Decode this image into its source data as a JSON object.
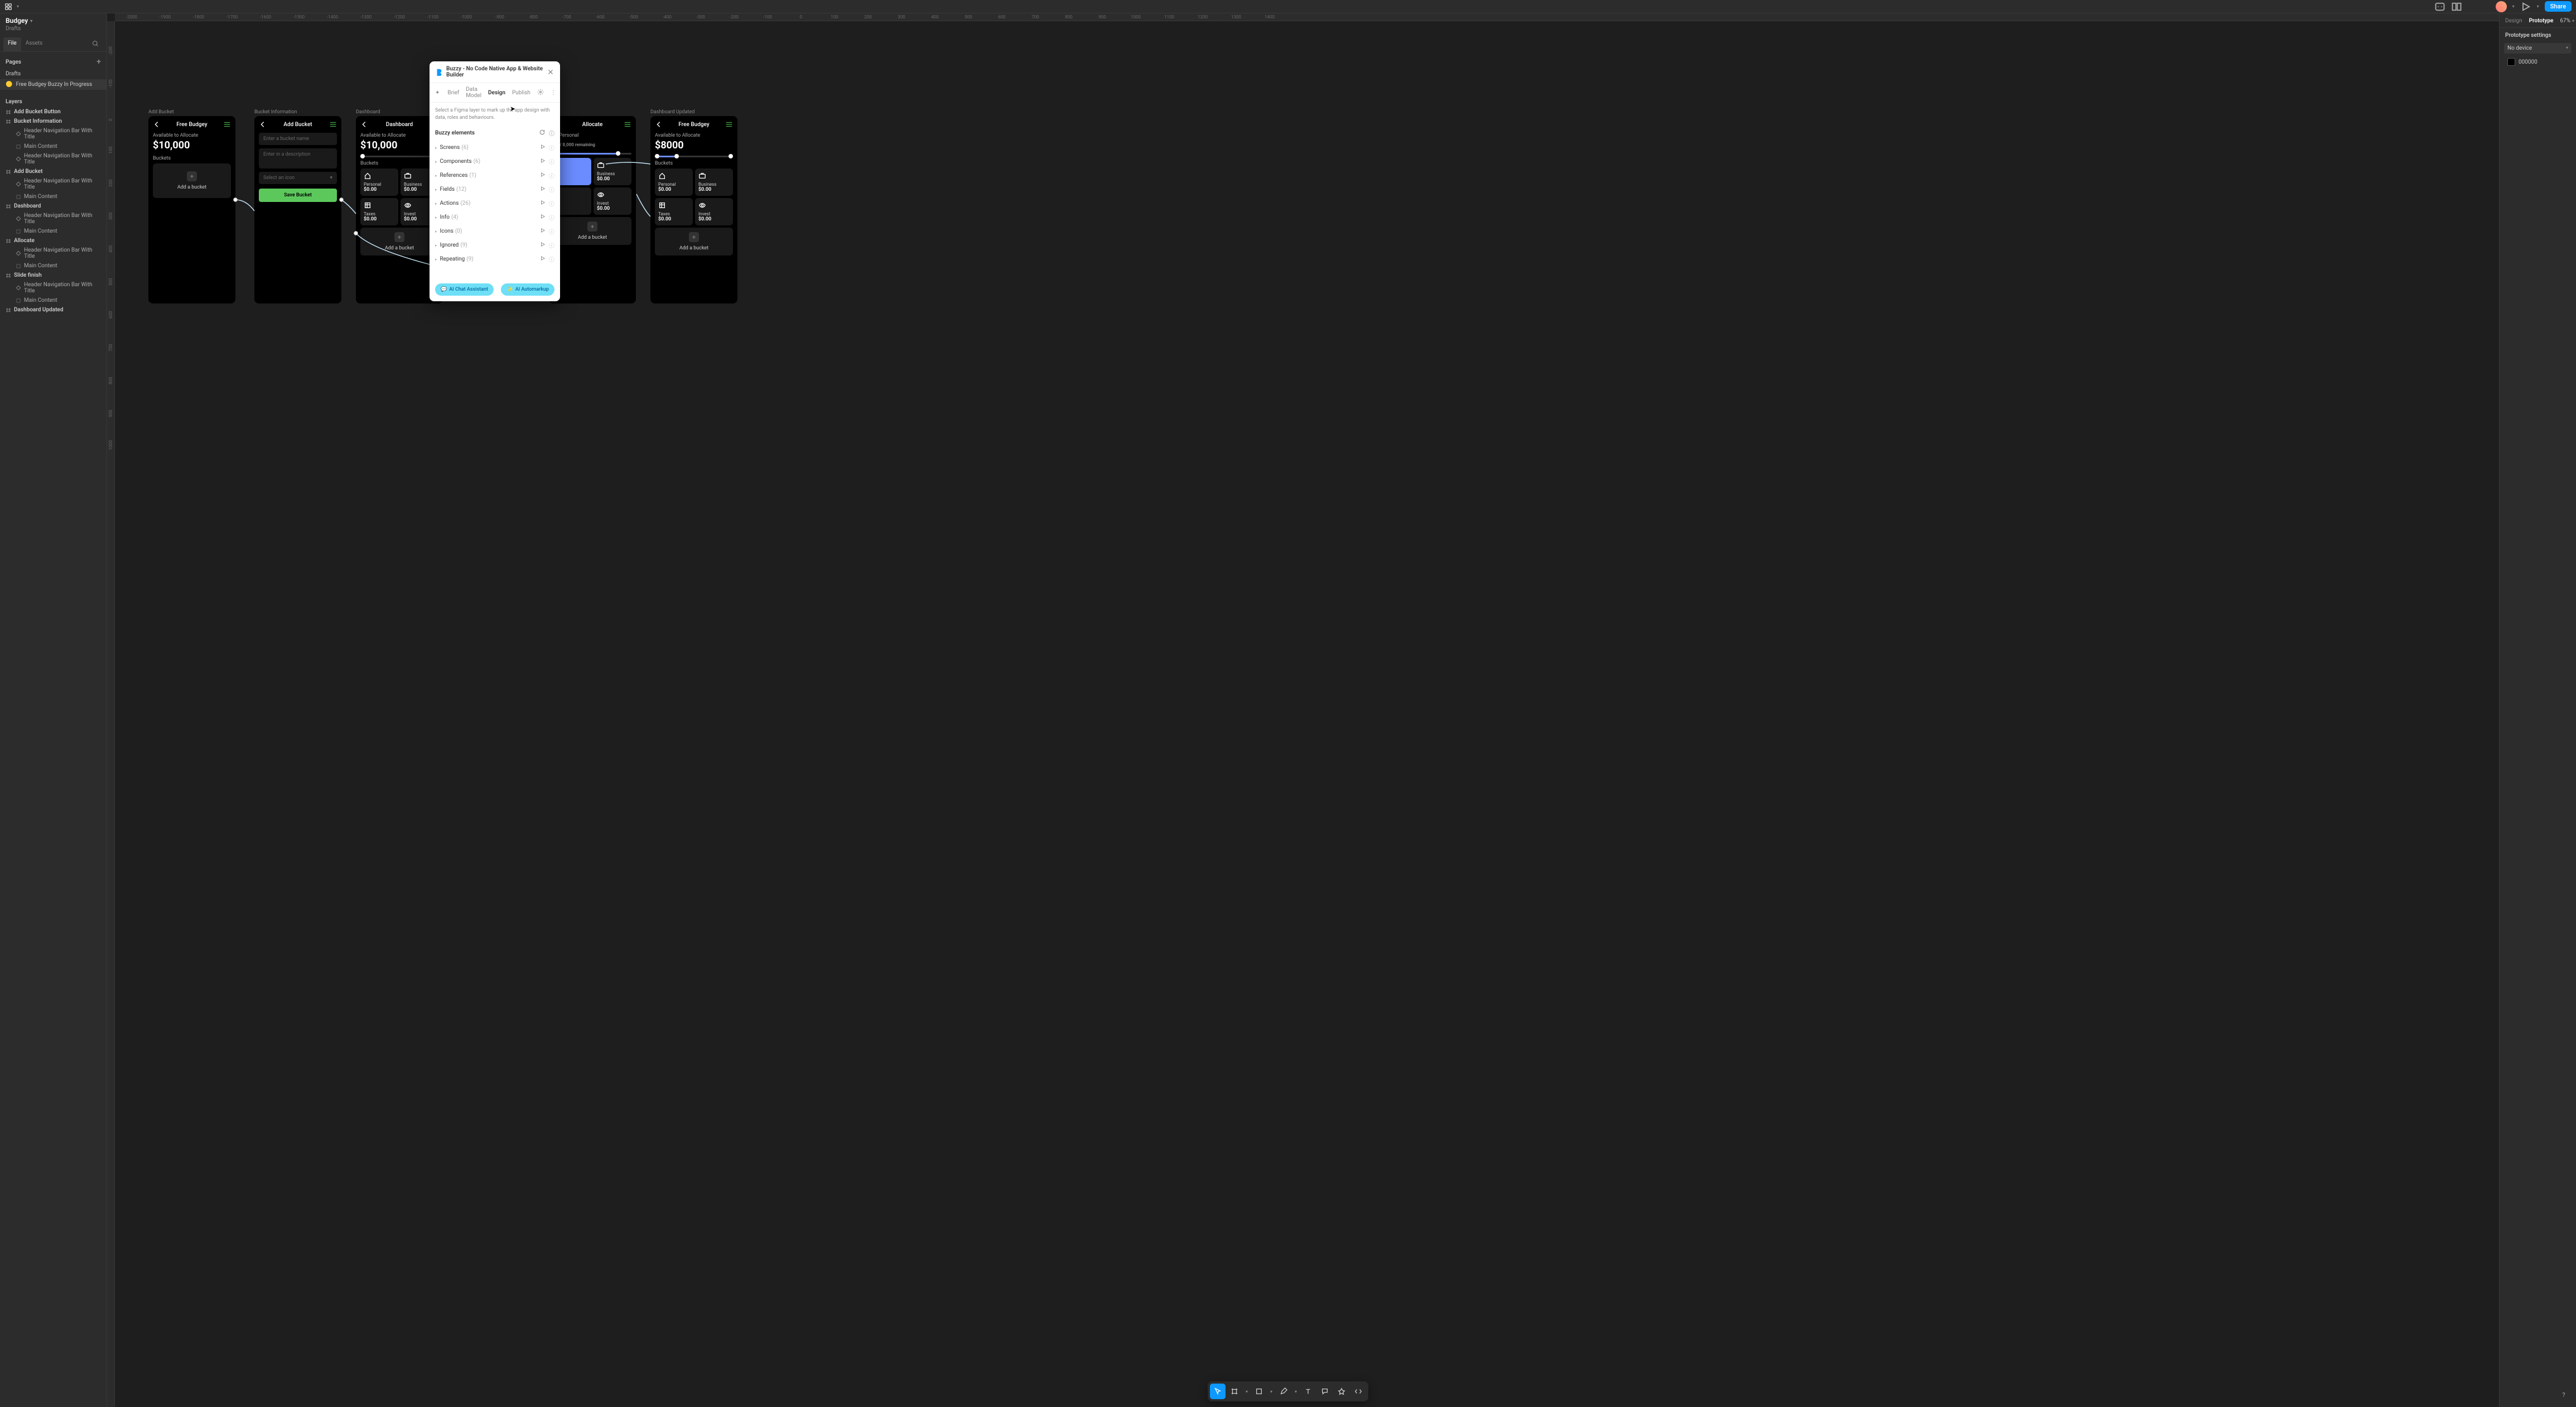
{
  "topbar": {
    "project": "Budgey",
    "subtitle": "Drafts",
    "share": "Share"
  },
  "leftPanel": {
    "tabs": {
      "file": "File",
      "assets": "Assets"
    },
    "pagesHeader": "Pages",
    "pages": [
      {
        "label": "Drafts"
      },
      {
        "label": "Free Budgey Buzzy In Progress",
        "emoji": "🟡",
        "selected": true
      }
    ],
    "layersHeader": "Layers",
    "layers": [
      {
        "label": "Add Bucket Button",
        "top": true,
        "icon": "hash"
      },
      {
        "label": "Bucket Information",
        "top": true,
        "icon": "hash"
      },
      {
        "label": "Header Navigation Bar With Title",
        "child": true,
        "icon": "diamond"
      },
      {
        "label": "Main Content",
        "child": true,
        "icon": "group"
      },
      {
        "label": "Header Navigation Bar With Title",
        "child": true,
        "icon": "diamond"
      },
      {
        "label": "Add Bucket",
        "top": true,
        "icon": "hash"
      },
      {
        "label": "Header Navigation Bar With Title",
        "child": true,
        "icon": "diamond"
      },
      {
        "label": "Main Content",
        "child": true,
        "icon": "group"
      },
      {
        "label": "Dashboard",
        "top": true,
        "icon": "hash"
      },
      {
        "label": "Header Navigation Bar With Title",
        "child": true,
        "icon": "diamond"
      },
      {
        "label": "Main Content",
        "child": true,
        "icon": "group"
      },
      {
        "label": "Allocate",
        "top": true,
        "icon": "hash"
      },
      {
        "label": "Header Navigation Bar With Title",
        "child": true,
        "icon": "diamond"
      },
      {
        "label": "Main Content",
        "child": true,
        "icon": "group"
      },
      {
        "label": "Slide finish",
        "top": true,
        "icon": "hash"
      },
      {
        "label": "Header Navigation Bar With Title",
        "child": true,
        "icon": "diamond"
      },
      {
        "label": "Main Content",
        "child": true,
        "icon": "group"
      },
      {
        "label": "Dashboard Updated",
        "top": true,
        "icon": "hash"
      }
    ]
  },
  "rightPanel": {
    "tabs": {
      "design": "Design",
      "prototype": "Prototype"
    },
    "zoom": "67%",
    "sectionTitle": "Prototype settings",
    "device": "No device",
    "color": "000000"
  },
  "ruler": [
    "-2000",
    "-1900",
    "-1800",
    "-1700",
    "-1600",
    "-1500",
    "-1400",
    "-1300",
    "-1200",
    "-1100",
    "-1000",
    "-900",
    "-800",
    "-700",
    "-600",
    "-500",
    "-400",
    "-300",
    "-200",
    "-100",
    "0",
    "100",
    "200",
    "300",
    "400",
    "500",
    "600",
    "700",
    "800",
    "900",
    "1000",
    "1100",
    "1200",
    "1300",
    "1400"
  ],
  "rulerV": [
    "-200",
    "-100",
    "0",
    "100",
    "200",
    "300",
    "400",
    "500",
    "600",
    "700",
    "800",
    "900",
    "1000"
  ],
  "frames": {
    "addBucket": {
      "label": "Add Bucket",
      "title": "Free Budgey",
      "subtitle": "Available to Allocate",
      "amount": "$10,000",
      "bucketsLbl": "Buckets",
      "addTxt": "Add a bucket"
    },
    "bucketInfo": {
      "label": "Bucket Information",
      "title": "Add Bucket",
      "ph1": "Enter a bucket name",
      "ph2": "Enter in a description",
      "iconSel": "Select an icon",
      "save": "Save Bucket"
    },
    "dashboard": {
      "label": "Dashboard",
      "title": "Dashboard",
      "subtitle": "Available to Allocate",
      "amount": "$10,000",
      "bucketsLbl": "Buckets",
      "cards": [
        {
          "name": "Personal",
          "amt": "$0.00"
        },
        {
          "name": "Business",
          "amt": "$0.00"
        },
        {
          "name": "Taxes",
          "amt": "$0.00"
        },
        {
          "name": "Invest",
          "amt": "$0.00"
        }
      ],
      "addTxt": "Add a bucket"
    },
    "allocate": {
      "label": "Allocate",
      "title": "Allocate",
      "toPersonal": "to Personal",
      "remaining": "/ 8,000 remaining",
      "cards": [
        {
          "name": "Business",
          "amt": "$0.00"
        },
        {
          "name": "",
          "amt": ""
        },
        {
          "name": "Invest",
          "amt": "$0.00"
        }
      ],
      "addTxt": "Add a bucket"
    },
    "dashboardUpd": {
      "label": "Dashboard Updated",
      "title": "Free Budgey",
      "subtitle": "Available to Allocate",
      "amount": "$8000",
      "bucketsLbl": "Buckets",
      "cards": [
        {
          "name": "Personal",
          "amt": "$0.00"
        },
        {
          "name": "Business",
          "amt": "$0.00"
        },
        {
          "name": "Taxes",
          "amt": "$0.00"
        },
        {
          "name": "Invest",
          "amt": "$0.00"
        }
      ],
      "addTxt": "Add a bucket"
    }
  },
  "modal": {
    "title": "Buzzy - No Code Native App & Website Builder",
    "tabs": {
      "brief": "Brief",
      "dataModel": "Data Model",
      "design": "Design",
      "publish": "Publish"
    },
    "hint": "Select a Figma layer to mark up the app design with data, roles and behaviours.",
    "sectionTitle": "Buzzy elements",
    "rows": [
      {
        "name": "Screens",
        "count": "(6)"
      },
      {
        "name": "Components",
        "count": "(6)"
      },
      {
        "name": "References",
        "count": "(1)"
      },
      {
        "name": "Fields",
        "count": "(12)"
      },
      {
        "name": "Actions",
        "count": "(26)"
      },
      {
        "name": "Info",
        "count": "(4)"
      },
      {
        "name": "Icons",
        "count": "(0)"
      },
      {
        "name": "Ignored",
        "count": "(9)"
      },
      {
        "name": "Repeating",
        "count": "(9)"
      }
    ],
    "btnChat": "AI Chat Assistant",
    "btnAuto": "AI Automarkup"
  }
}
